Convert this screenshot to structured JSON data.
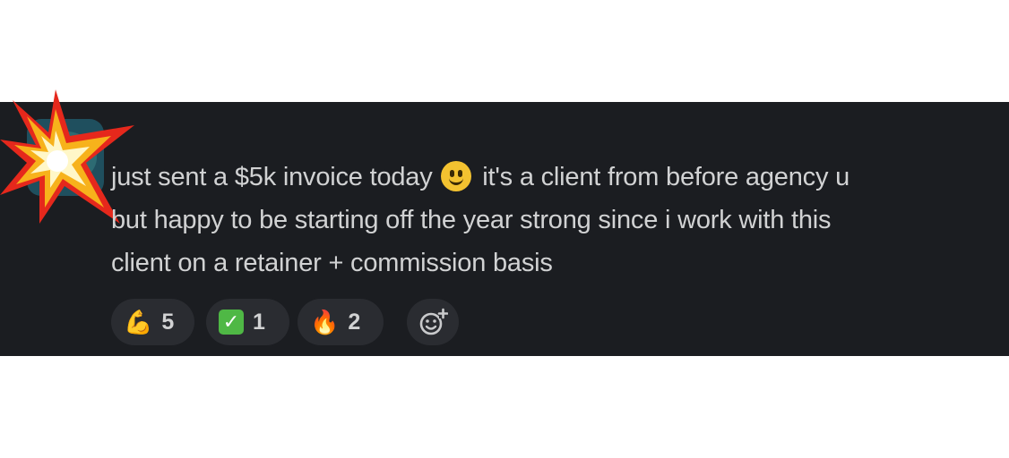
{
  "message": {
    "lines": [
      "just sent a $5k invoice today",
      "it's a client from before agency u",
      "but happy to be starting off the year strong since i work with this",
      "client on a retainer + commission basis"
    ],
    "inline_emoji": "slightly-smiling-face-icon"
  },
  "reactions": [
    {
      "icon": "flexed-biceps-icon",
      "count": "5"
    },
    {
      "icon": "check-mark-button-icon",
      "count": "1"
    },
    {
      "icon": "fire-icon",
      "count": "2"
    }
  ],
  "add_reaction": {
    "icon": "add-emoji-icon"
  },
  "decoration": {
    "icon": "collision-burst-icon"
  },
  "colors": {
    "background": "#1b1d21",
    "text": "#d1d2d3",
    "pill": "#2a2c31",
    "check": "#4fb845",
    "smiley": "#f3c230"
  }
}
